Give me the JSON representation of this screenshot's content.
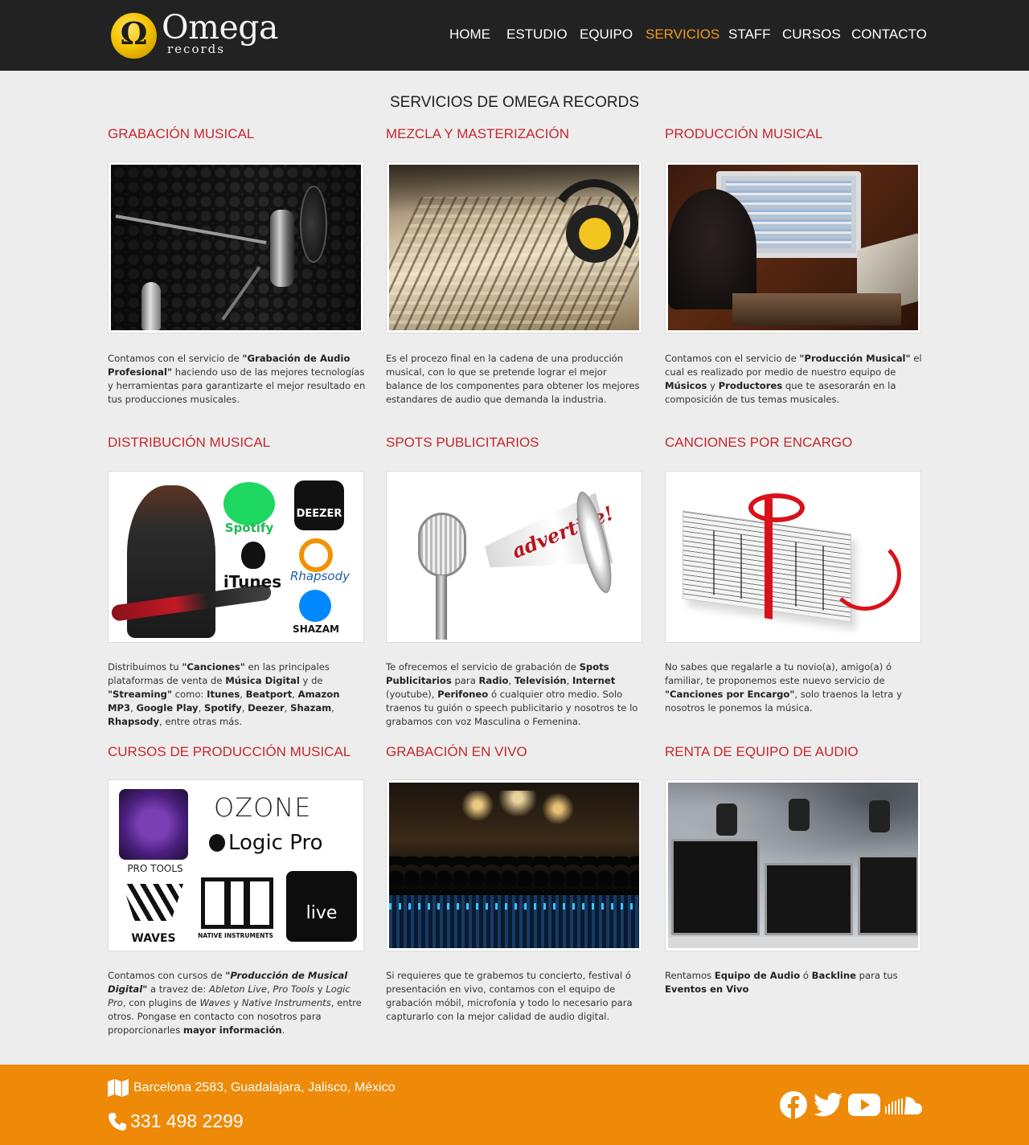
{
  "brand": {
    "name": "Omega",
    "sub": "records"
  },
  "nav": [
    "HOME",
    "ESTUDIO",
    "EQUIPO",
    "SERVICIOS",
    "STAFF",
    "CURSOS",
    "CONTACTO"
  ],
  "nav_active_index": 3,
  "colors": {
    "header_bg": "#222222",
    "accent": "#f29a1d",
    "service_title": "#c6272e",
    "footer_bg": "#ee8a07",
    "page_bg": "#ededed"
  },
  "page_title": "SERVICIOS DE OMEGA RECORDS",
  "services": [
    {
      "title": "GRABACIÓN MUSICAL",
      "image": "studio-microphone-photo",
      "text": [
        "Contamos con el servicio de ",
        {
          "b": "\"Grabación de Audio Profesional\""
        },
        " haciendo uso de las mejores tecnologías y herramientas para garantizarte el mejor resultado en tus producciones musicales."
      ]
    },
    {
      "title": "MEZCLA Y MASTERIZACIÓN",
      "image": "mixing-console-headphones-photo",
      "text": [
        "Es el procezo final en la cadena de una producción musical, con lo que se pretende lograr el mejor balance de los componentes para obtener los mejores estandares de audio que demanda la industria."
      ]
    },
    {
      "title": "PRODUCCIÓN MUSICAL",
      "image": "producer-daw-computer-photo",
      "text": [
        "Contamos con el servicio de ",
        {
          "b": "\"Producción Musical\""
        },
        " el cual es realizado por medio de nuestro equipo de ",
        {
          "b": "Músicos"
        },
        " y ",
        {
          "b": "Productores"
        },
        " que te asesorarán en la composición de tus temas musicales."
      ]
    },
    {
      "title": "DISTRIBUCIÓN MUSICAL",
      "image": "guitarist-streaming-logos",
      "logos": [
        "Spotify",
        "DEEZER",
        "iTunes",
        "Rhapsody",
        "SHAZAM"
      ],
      "text": [
        "Distribuimos tu ",
        {
          "b": "\"Canciones\""
        },
        " en las principales plataformas de venta de ",
        {
          "b": "Música Digital"
        },
        " y de ",
        {
          "b": "\"Streaming\""
        },
        " como: ",
        {
          "b": "Itunes"
        },
        ", ",
        {
          "b": "Beatport"
        },
        ", ",
        {
          "b": "Amazon MP3"
        },
        ", ",
        {
          "b": "Google Play"
        },
        ", ",
        {
          "b": "Spotify"
        },
        ", ",
        {
          "b": "Deezer"
        },
        ", ",
        {
          "b": "Shazam"
        },
        ", ",
        {
          "b": "Rhapsody"
        },
        ", entre otras más."
      ]
    },
    {
      "title": "SPOTS PUBLICITARIOS",
      "image": "microphone-megaphone-advertise",
      "megaphone_text": "advertise!",
      "text": [
        "Te ofrecemos el servicio de grabación de ",
        {
          "b": "Spots Publicitarios"
        },
        " para ",
        {
          "b": "Radio"
        },
        ", ",
        {
          "b": "Televisión"
        },
        ", ",
        {
          "b": "Internet"
        },
        " (youtube), ",
        {
          "b": "Perifoneo"
        },
        " ó cualquier otro medio. Solo traenos tu guión o speech publicitario y nosotros te lo grabamos con voz Masculina o Femenina."
      ]
    },
    {
      "title": "CANCIONES POR ENCARGO",
      "image": "sheet-music-gift-box",
      "text": [
        "No sabes que regalarle a tu novio(a), amigo(a) ó familiar, te proponemos este nuevo servicio de ",
        {
          "b": "\"Canciones por Encargo\""
        },
        ", solo traenos la letra y nosotros le ponemos la música."
      ]
    },
    {
      "title": "CURSOS DE PRODUCCIÓN MUSICAL",
      "image": "software-logos",
      "logos": [
        "PRO TOOLS",
        "OZONE",
        "Logic Pro",
        "WAVES",
        "NATIVE INSTRUMENTS",
        "live"
      ],
      "text": [
        "Contamos con cursos de ",
        {
          "bi": "\"Producción de Musical Digital\""
        },
        " a travez de: ",
        {
          "i": "Ableton Live"
        },
        ", ",
        {
          "i": "Pro Tools"
        },
        " y ",
        {
          "i": "Logic Pro"
        },
        ", con plugins de ",
        {
          "i": "Waves"
        },
        " y ",
        {
          "i": "Native Instruments"
        },
        ", entre otros. Pongase en contacto con nosotros para proporcionarles ",
        {
          "b": "mayor información"
        },
        "."
      ]
    },
    {
      "title": "GRABACIÓN EN VIVO",
      "image": "live-concert-console-photo",
      "text": [
        "Si requieres que te grabemos tu concierto, festival ó presentación en vivo, contamos con el equipo de grabación móbil, microfonía y todo lo necesario para capturarlo con la mejor calidad de audio digital."
      ]
    },
    {
      "title": "RENTA DE EQUIPO DE AUDIO",
      "image": "flight-cases-lights-photo",
      "text": [
        "Rentamos ",
        {
          "b": "Equipo de Audio"
        },
        " ó ",
        {
          "b": "Backline"
        },
        " para tus ",
        {
          "b": "Eventos en Vivo"
        }
      ]
    }
  ],
  "footer": {
    "address": "Barcelona 2583, Guadalajara, Jalisco, México",
    "phone": "331 498 2299",
    "icons": [
      "map-icon",
      "phone-icon",
      "facebook-icon",
      "twitter-icon",
      "youtube-icon",
      "soundcloud-icon"
    ]
  }
}
